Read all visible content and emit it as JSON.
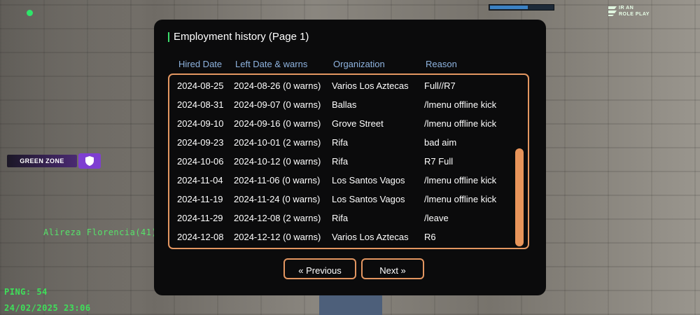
{
  "hud": {
    "health_fraction": 0.6,
    "logo": {
      "line1": "IR AN",
      "line2": "ROLE PLAY"
    },
    "zone_label": "GREEN ZONE",
    "player_name": "Alireza Florencia(41)",
    "ping": "PING: 54",
    "datetime": "24/02/2025 23:06"
  },
  "dialog": {
    "title": "Employment history (Page 1)",
    "columns": [
      "Hired Date",
      "Left Date & warns",
      "Organization",
      "Reason"
    ],
    "rows": [
      [
        "2024-08-25",
        "2024-08-26 (0 warns)",
        "Varios Los Aztecas",
        "Full//R7"
      ],
      [
        "2024-08-31",
        "2024-09-07 (0 warns)",
        "Ballas",
        "/lmenu offline kick"
      ],
      [
        "2024-09-10",
        "2024-09-16 (0 warns)",
        "Grove Street",
        "/lmenu offline kick"
      ],
      [
        "2024-09-23",
        "2024-10-01 (2 warns)",
        "Rifa",
        "bad aim"
      ],
      [
        "2024-10-06",
        "2024-10-12 (0 warns)",
        "Rifa",
        "R7 Full"
      ],
      [
        "2024-11-04",
        "2024-11-06 (0 warns)",
        "Los Santos Vagos",
        "/lmenu offline kick"
      ],
      [
        "2024-11-19",
        "2024-11-24 (0 warns)",
        "Los Santos Vagos",
        "/lmenu offline kick"
      ],
      [
        "2024-11-29",
        "2024-12-08 (2 warns)",
        "Rifa",
        "/leave"
      ],
      [
        "2024-12-08",
        "2024-12-12 (0 warns)",
        "Varios Los Aztecas",
        "R6"
      ]
    ],
    "previous_label": "« Previous",
    "next_label": "Next »"
  },
  "colors": {
    "accent_orange": "#e39661",
    "header_blue": "#8fb4e0",
    "title_green": "#3bdc6b",
    "hud_green": "#3fe05a",
    "zone_purple": "#7e3fd1"
  }
}
